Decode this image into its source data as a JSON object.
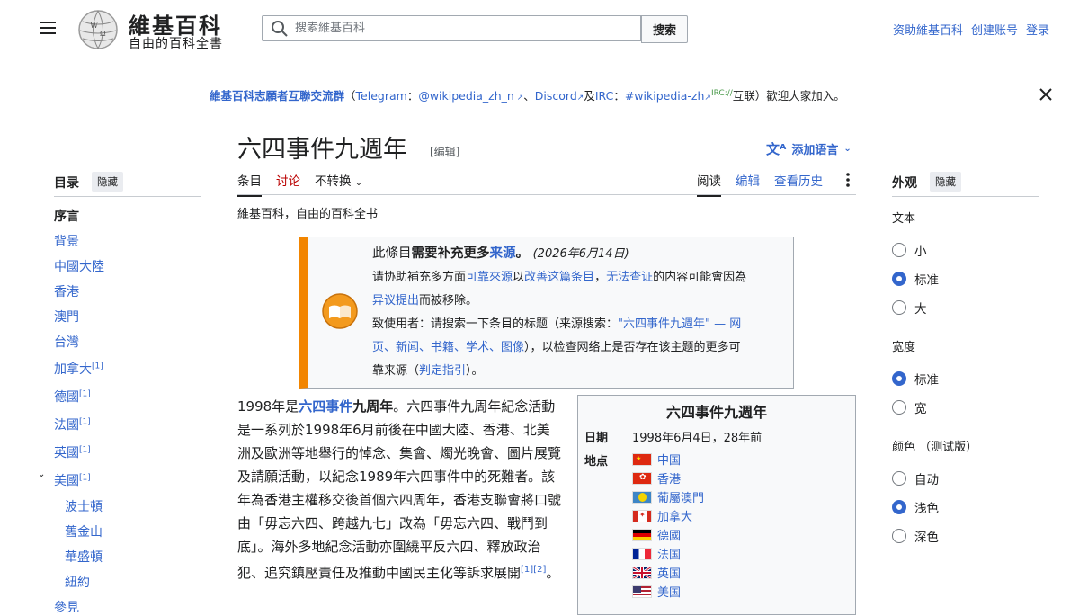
{
  "header": {
    "logo_title": "維基百科",
    "logo_subtitle": "自由的百科全書",
    "search_placeholder": "搜索維基百科",
    "search_button": "搜索",
    "top_links": [
      "资助維基百科",
      "创建账号",
      "登录"
    ]
  },
  "banner": {
    "group": "維基百科志願者互聯交流群",
    "open": "（",
    "telegram": "Telegram",
    "colon": "：",
    "tg_handle": "@wikipedia_zh_n",
    "sep": "、",
    "discord": "Discord",
    "and": "及",
    "irc": "IRC",
    "irc_colon": "：",
    "irc_channel": "#wikipedia-zh",
    "irc_sup": "IRC://",
    "tail": "互联）歡迎大家加入。"
  },
  "article": {
    "title": "六四事件九週年",
    "title_edit": "[编辑]",
    "add_languages": "添加语言",
    "tabs_left": [
      "条目",
      "讨论",
      "不转换"
    ],
    "tabs_right": [
      "阅读",
      "编辑",
      "查看历史"
    ],
    "tagline": "維基百科，自由的百科全书"
  },
  "toc": {
    "heading": "目录",
    "hide": "隐藏",
    "items": [
      {
        "label": "序言",
        "sup": ""
      },
      {
        "label": "背景",
        "sup": ""
      },
      {
        "label": "中國大陸",
        "sup": ""
      },
      {
        "label": "香港",
        "sup": ""
      },
      {
        "label": "澳門",
        "sup": ""
      },
      {
        "label": "台灣",
        "sup": ""
      },
      {
        "label": "加拿大",
        "sup": "[1]"
      },
      {
        "label": "德國",
        "sup": "[1]"
      },
      {
        "label": "法國",
        "sup": "[1]"
      },
      {
        "label": "英國",
        "sup": "[1]"
      },
      {
        "label": "美國",
        "sup": "[1]"
      }
    ],
    "subitems": [
      "波士頓",
      "舊金山",
      "華盛頓",
      "紐約"
    ],
    "last_partial": "參見"
  },
  "appearance": {
    "heading": "外观",
    "hide": "隐藏",
    "text_label": "文本",
    "text_options": [
      "小",
      "标准",
      "大"
    ],
    "text_selected": "标准",
    "width_label": "宽度",
    "width_options": [
      "标准",
      "宽"
    ],
    "width_selected": "标准",
    "color_label": "颜色 （测试版）",
    "color_options": [
      "自动",
      "浅色",
      "深色"
    ],
    "color_selected": "浅色"
  },
  "ambox": {
    "line1_a": "此條目",
    "line1_b": "需要补充更多",
    "line1_c": "来源",
    "line1_d": "。",
    "line1_date": "(2026年6月14日)",
    "line2_a": "请协助補充多方面",
    "line2_b": "可靠來源",
    "line2_c": "以",
    "line2_d": "改善这篇条目",
    "line2_e": "，",
    "line2_f": "无法查证",
    "line2_g": "的内容可能會因為",
    "line3_a": "异议提出",
    "line3_b": "而被移除。",
    "line4_a": "致使用者：请搜索一下条目的标题（来源搜索：",
    "line4_b": "\"六四事件九週年\" — 网",
    "line5_a": "页、新闻、书籍、学术、图像",
    "line5_b": "），以检查网络上是否存在该主题的更多可",
    "line6_a": "靠来源（",
    "line6_b": "判定指引",
    "line6_c": "）。"
  },
  "body": {
    "p1": "1998年是",
    "p1_link": "六四事件",
    "p1_bold": "九周年",
    "p1_rest": "。六四事件九周年紀念活動是一系列於1998年6月前後在中國大陸、香港、北美洲及歐洲等地舉行的悼念、集會、燭光晚會、圖片展覽及請願活動，以紀念1989年六四事件中的死難者。該年為香港主權移交後首個六四周年，香港支聯會將口號由「毋忘六四、跨越九七」改為「毋忘六四、戰鬥到底」。海外多地紀念活動亦圍繞平反六四、釋放政治犯、追究鎮壓責任及推動中國民主化等訴求展開",
    "p1_refs": "[1][2]",
    "p1_end": "。"
  },
  "infobox": {
    "title": "六四事件九週年",
    "date_key": "日期",
    "date_val": "1998年6月4日，28年前",
    "place_key": "地点",
    "places": [
      "中国",
      "香港",
      "葡屬澳門",
      "加拿大",
      "德國",
      "法国",
      "英国",
      "美国"
    ]
  }
}
